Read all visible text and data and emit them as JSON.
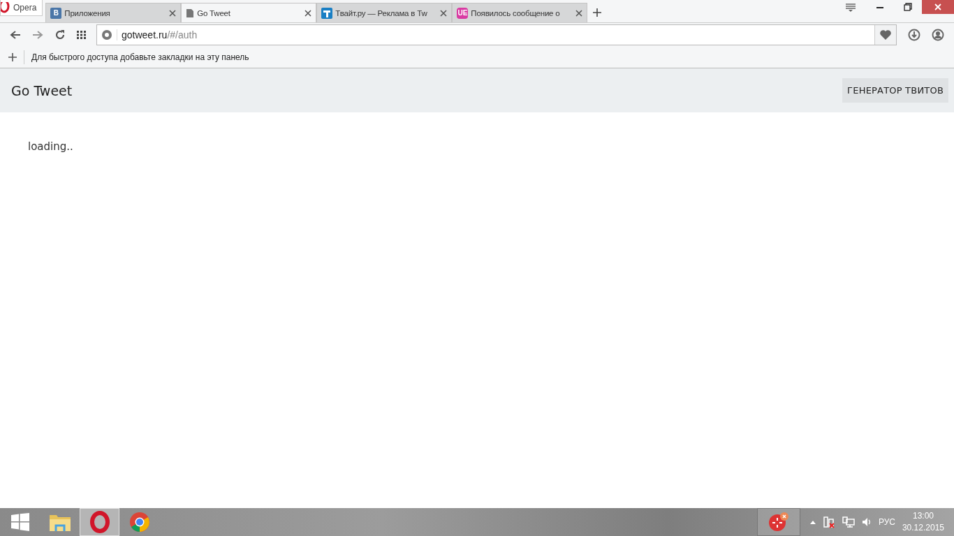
{
  "browser": {
    "menu_label": "Opera",
    "tabs": [
      {
        "kind": "vk",
        "label": "Приложения",
        "selected": false
      },
      {
        "kind": "page",
        "label": "Go Tweet",
        "selected": true
      },
      {
        "kind": "tvait",
        "label": "Твайт.ру — Реклама в Tw",
        "selected": false
      },
      {
        "kind": "ue",
        "label": "Появилось сообщение о",
        "selected": false
      }
    ],
    "tab_icon_text": {
      "vk": "В",
      "ue": "UE"
    },
    "address": {
      "host": "gotweet.ru",
      "path": "/#/auth"
    },
    "bookmarks_hint": "Для быстрого доступа добавьте закладки на эту панель"
  },
  "site": {
    "title": "Go Tweet",
    "nav_button": "ГЕНЕРАТОР ТВИТОВ",
    "status": "loading.."
  },
  "taskbar": {
    "apps": [
      {
        "kind": "explorer",
        "selected": false
      },
      {
        "kind": "opera",
        "selected": true
      },
      {
        "kind": "chrome",
        "selected": false
      }
    ],
    "language": "РУС",
    "time": "13:00",
    "date": "30.12.2015"
  }
}
